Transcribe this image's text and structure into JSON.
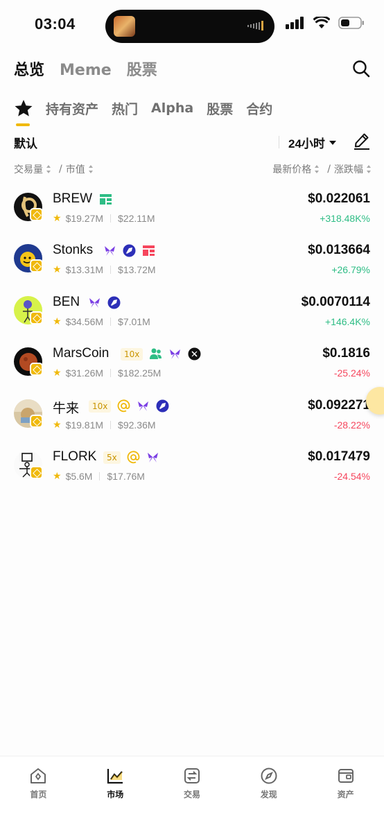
{
  "status_bar": {
    "time": "03:04"
  },
  "top_tabs": [
    {
      "label": "总览",
      "active": true
    },
    {
      "label": "Meme",
      "active": false
    },
    {
      "label": "股票",
      "active": false
    }
  ],
  "sub_tabs": [
    {
      "label": "持有资产"
    },
    {
      "label": "热门"
    },
    {
      "label": "Alpha"
    },
    {
      "label": "股票"
    },
    {
      "label": "合约"
    }
  ],
  "filter": {
    "default_label": "默认",
    "time_range": "24小时"
  },
  "sort_header": {
    "left_a": "交易量",
    "left_sep": "/",
    "left_b": "市值",
    "right_a": "最新价格",
    "right_sep": "/",
    "right_b": "涨跌幅"
  },
  "coins": [
    {
      "name": "BREW",
      "leverage": "",
      "tags": [
        "listing-icon"
      ],
      "volume": "$19.27M",
      "market_cap": "$22.11M",
      "price": "$0.022061",
      "change": "+318.48K%",
      "direction": "up"
    },
    {
      "name": "Stonks",
      "leverage": "",
      "tags": [
        "butterfly-icon",
        "rocket-badge-icon",
        "listing-red-icon"
      ],
      "volume": "$13.31M",
      "market_cap": "$13.72M",
      "price": "$0.013664",
      "change": "+26.79%",
      "direction": "up"
    },
    {
      "name": "BEN",
      "leverage": "",
      "tags": [
        "butterfly-icon",
        "rocket-badge-icon"
      ],
      "volume": "$34.56M",
      "market_cap": "$7.01M",
      "price": "$0.0070114",
      "change": "+146.4K%",
      "direction": "up"
    },
    {
      "name": "MarsCoin",
      "leverage": "10x",
      "tags": [
        "community-icon",
        "butterfly-icon",
        "x-logo-icon"
      ],
      "volume": "$31.26M",
      "market_cap": "$182.25M",
      "price": "$0.1816",
      "change": "-25.24%",
      "direction": "down"
    },
    {
      "name": "牛来",
      "leverage": "10x",
      "tags": [
        "at-icon",
        "butterfly-icon",
        "rocket-badge-icon"
      ],
      "volume": "$19.81M",
      "market_cap": "$92.36M",
      "price": "$0.092271",
      "change": "-28.22%",
      "direction": "down"
    },
    {
      "name": "FLORK",
      "leverage": "5x",
      "tags": [
        "at-icon",
        "butterfly-icon"
      ],
      "volume": "$5.6M",
      "market_cap": "$17.76M",
      "price": "$0.017479",
      "change": "-24.54%",
      "direction": "down"
    }
  ],
  "bottom_nav": [
    {
      "label": "首页",
      "icon": "home-icon",
      "active": false
    },
    {
      "label": "市场",
      "icon": "market-chart-icon",
      "active": true
    },
    {
      "label": "交易",
      "icon": "trade-icon",
      "active": false
    },
    {
      "label": "发现",
      "icon": "discover-icon",
      "active": false
    },
    {
      "label": "资产",
      "icon": "wallet-icon",
      "active": false
    }
  ],
  "colors": {
    "accent": "#f0b90b",
    "up": "#2ebd85",
    "down": "#f6465d"
  }
}
